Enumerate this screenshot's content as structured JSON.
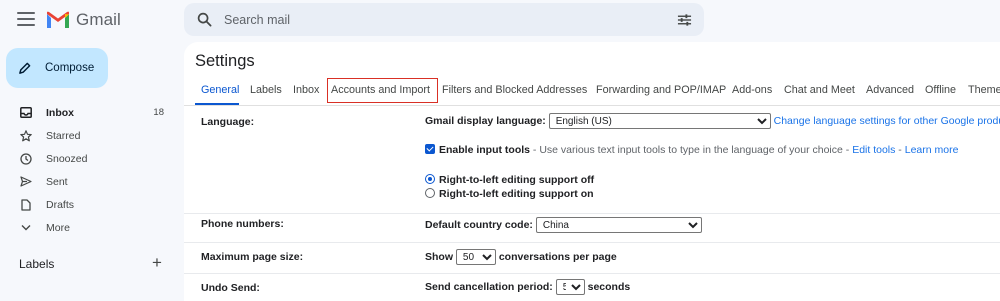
{
  "app": {
    "name": "Gmail"
  },
  "search": {
    "placeholder": "Search mail"
  },
  "compose": {
    "label": "Compose"
  },
  "sidebar": {
    "items": [
      {
        "label": "Inbox",
        "count": "18",
        "icon": "inbox-icon"
      },
      {
        "label": "Starred",
        "icon": "star-icon"
      },
      {
        "label": "Snoozed",
        "icon": "clock-icon"
      },
      {
        "label": "Sent",
        "icon": "send-icon"
      },
      {
        "label": "Drafts",
        "icon": "draft-icon"
      },
      {
        "label": "More",
        "icon": "chevron-down-icon"
      }
    ],
    "labels_heading": "Labels",
    "labels_add": "+"
  },
  "settings": {
    "title": "Settings",
    "tabs": [
      "General",
      "Labels",
      "Inbox",
      "Accounts and Import",
      "Filters and Blocked Addresses",
      "Forwarding and POP/IMAP",
      "Add-ons",
      "Chat and Meet",
      "Advanced",
      "Offline",
      "Themes"
    ],
    "language": {
      "label": "Language:",
      "display_label": "Gmail display language:",
      "display_value": "English (US)",
      "change_link": "Change language settings for other Google products",
      "input_tools_label": "Enable input tools",
      "input_tools_desc": " - Use various text input tools to type in the language of your choice - ",
      "edit_tools": "Edit tools",
      "sep": " - ",
      "learn_more": "Learn more",
      "rtl_off": "Right-to-left editing support off",
      "rtl_on": "Right-to-left editing support on"
    },
    "phone": {
      "label": "Phone numbers:",
      "country_label": "Default country code:",
      "country_value": "China"
    },
    "page_size": {
      "label": "Maximum page size:",
      "show": "Show",
      "value": "50",
      "suffix": "conversations per page"
    },
    "undo": {
      "label": "Undo Send:",
      "period_label": "Send cancellation period:",
      "value": "5",
      "suffix": "seconds"
    }
  },
  "colors": {
    "accent": "#0b57d0",
    "compose_bg": "#c2e7ff",
    "highlight": "#d93025"
  }
}
